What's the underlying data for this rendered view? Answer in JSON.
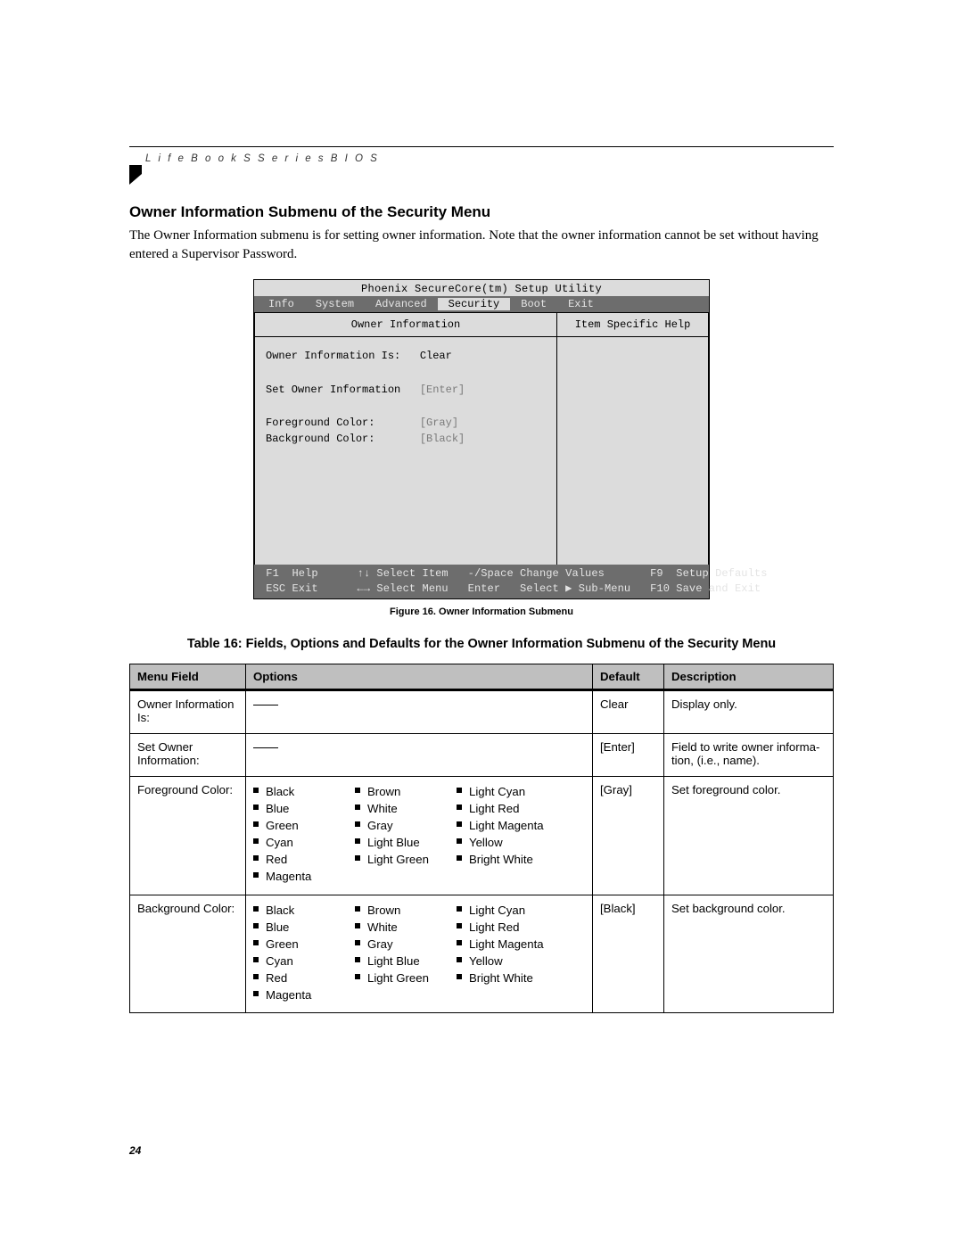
{
  "header": {
    "running_head": "L i f e B o o k   S   S e r i e s   B I O S"
  },
  "section": {
    "heading": "Owner Information Submenu of the Security Menu",
    "paragraph": "The Owner Information submenu is for setting owner information. Note that the owner information cannot be set without having entered a Supervisor Password."
  },
  "bios": {
    "title": "Phoenix SecureCore(tm) Setup Utility",
    "tabs": [
      "Info",
      "System",
      "Advanced",
      "Security",
      "Boot",
      "Exit"
    ],
    "active_tab_index": 3,
    "left_heading": "Owner Information",
    "right_heading": "Item Specific Help",
    "rows": [
      {
        "label": "Owner Information Is:",
        "value": "Clear",
        "dim": false
      },
      {
        "label": "",
        "value": "",
        "dim": false
      },
      {
        "label": "Set Owner Information",
        "value": "[Enter]",
        "dim": true
      },
      {
        "label": "",
        "value": "",
        "dim": false
      },
      {
        "label": "Foreground Color:",
        "value": "[Gray]",
        "dim": true
      },
      {
        "label": "Background Color:",
        "value": "[Black]",
        "dim": true
      }
    ],
    "footer": {
      "f1": "F1",
      "help": "Help",
      "updown": "↑↓",
      "select_item": "Select Item",
      "minus_space": "-/Space",
      "change_values": "Change Values",
      "f9": "F9",
      "setup_defaults": "Setup Defaults",
      "esc": "ESC",
      "exit": "Exit",
      "leftright": "←→",
      "select_menu": "Select Menu",
      "enter": "Enter",
      "select_submenu": "Select ▶ Sub-Menu",
      "f10": "F10",
      "save_exit": "Save and Exit"
    }
  },
  "figure_caption": "Figure 16.   Owner Information Submenu",
  "table_caption": "Table 16: Fields, Options and Defaults for the Owner Information Submenu of the Security Menu",
  "table": {
    "headers": [
      "Menu Field",
      "Options",
      "Default",
      "Description"
    ],
    "rows": [
      {
        "menu_field": "Owner Information Is:",
        "options_type": "dash",
        "default": "Clear",
        "description": "Display only."
      },
      {
        "menu_field": "Set Owner Informa­tion:",
        "options_type": "dash",
        "default": "[Enter]",
        "description": "Field to write owner informa­tion, (i.e., name)."
      },
      {
        "menu_field": "Foreground Color:",
        "options_type": "colors",
        "default": "[Gray]",
        "description": "Set foreground color."
      },
      {
        "menu_field": "Background Color:",
        "options_type": "colors",
        "default": "[Black]",
        "description": "Set background color."
      }
    ],
    "color_columns": [
      [
        "Black",
        "Blue",
        "Green",
        "Cyan",
        "Red",
        "Magenta"
      ],
      [
        "Brown",
        "White",
        "Gray",
        "Light Blue",
        "Light Green"
      ],
      [
        "Light Cyan",
        "Light Red",
        "Light Magenta",
        "Yellow",
        "Bright White"
      ]
    ]
  },
  "page_number": "24"
}
